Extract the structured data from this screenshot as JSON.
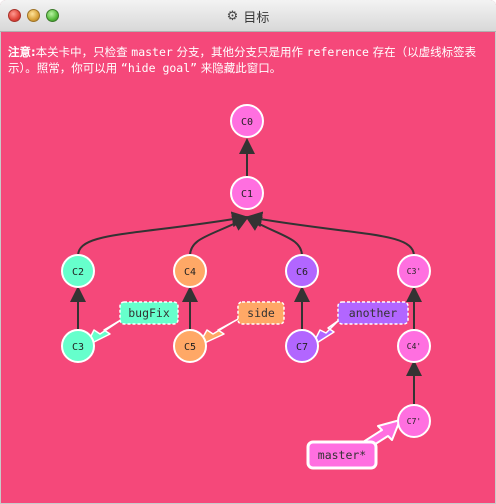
{
  "window": {
    "title": "目标",
    "title_icon": "gear-icon"
  },
  "note": {
    "label": "注意:",
    "text_1": "本关卡中，只检查 ",
    "code_1": "master",
    "text_2": " 分支，其他分支只是用作 ",
    "code_2": "reference",
    "text_3": " 存在（以虚线标签表示）。照常，你可以用 ",
    "code_3": "“hide goal”",
    "text_4": " 来隐藏此窗口。"
  },
  "commits": {
    "c0": "C0",
    "c1": "C1",
    "c2": "C2",
    "c3": "C3",
    "c4": "C4",
    "c5": "C5",
    "c6": "C6",
    "c7": "C7",
    "c3p": "C3'",
    "c4p": "C4'",
    "c7p": "C7'"
  },
  "branches": {
    "bugfix": "bugFix",
    "side": "side",
    "another": "another",
    "master": "master*"
  },
  "colors": {
    "background": "#f5487a",
    "c_pink": "#ff6fe0",
    "c_teal": "#66ffcc",
    "c_orange": "#ffa866",
    "c_purple": "#b266ff"
  }
}
